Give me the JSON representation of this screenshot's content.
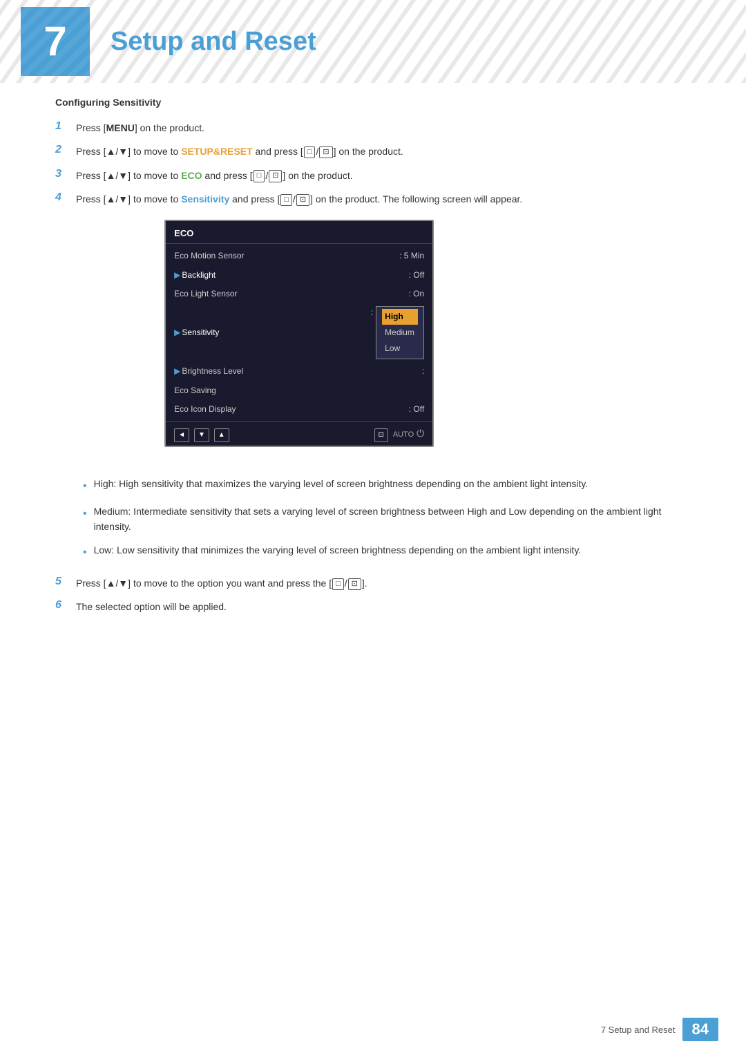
{
  "header": {
    "chapter_number": "7",
    "title": "Setup and Reset"
  },
  "section": {
    "heading": "Configuring Sensitivity"
  },
  "steps": [
    {
      "number": "1",
      "parts": [
        {
          "text": "Press [",
          "style": "normal"
        },
        {
          "text": "MENU",
          "style": "bold"
        },
        {
          "text": "] on the product.",
          "style": "normal"
        }
      ]
    },
    {
      "number": "2",
      "parts": [
        {
          "text": "Press [▲/▼] to move to ",
          "style": "normal"
        },
        {
          "text": "SETUP&RESET",
          "style": "orange"
        },
        {
          "text": " and press [",
          "style": "normal"
        },
        {
          "text": "□/⊡",
          "style": "icon"
        },
        {
          "text": "] on the product.",
          "style": "normal"
        }
      ]
    },
    {
      "number": "3",
      "parts": [
        {
          "text": "Press [▲/▼] to move to ",
          "style": "normal"
        },
        {
          "text": "ECO",
          "style": "green"
        },
        {
          "text": " and press [",
          "style": "normal"
        },
        {
          "text": "□/⊡",
          "style": "icon"
        },
        {
          "text": "] on the product.",
          "style": "normal"
        }
      ]
    },
    {
      "number": "4",
      "parts": [
        {
          "text": "Press [▲/▼] to move to ",
          "style": "normal"
        },
        {
          "text": "Sensitivity",
          "style": "blue"
        },
        {
          "text": " and press [",
          "style": "normal"
        },
        {
          "text": "□/⊡",
          "style": "icon"
        },
        {
          "text": "] on the product. The following screen will appear.",
          "style": "normal"
        }
      ]
    },
    {
      "number": "5",
      "parts": [
        {
          "text": "Press [▲/▼] to move to the option you want and press the [",
          "style": "normal"
        },
        {
          "text": "□/⊡",
          "style": "icon"
        },
        {
          "text": "].",
          "style": "normal"
        }
      ]
    },
    {
      "number": "6",
      "parts": [
        {
          "text": "The selected option will be applied.",
          "style": "normal"
        }
      ]
    }
  ],
  "menu": {
    "title": "ECO",
    "rows": [
      {
        "label": "Eco Motion Sensor",
        "value": ": 5 Min",
        "arrow": false
      },
      {
        "label": "Backlight",
        "value": ": Off",
        "arrow": true
      },
      {
        "label": "Eco Light Sensor",
        "value": ": On",
        "arrow": false
      },
      {
        "label": "Sensitivity",
        "value": "",
        "arrow": true,
        "has_submenu": true
      },
      {
        "label": "Brightness Level",
        "value": ":",
        "arrow": true
      },
      {
        "label": "Eco Saving",
        "value": "",
        "arrow": false
      },
      {
        "label": "Eco Icon Display",
        "value": ": Off",
        "arrow": false
      }
    ],
    "submenu_items": [
      "High",
      "Medium",
      "Low"
    ],
    "submenu_highlighted": "High"
  },
  "bullets": [
    {
      "label": "High",
      "label_style": "blue",
      "text": ": High sensitivity that maximizes the varying level of screen brightness depending on the ambient light intensity."
    },
    {
      "label": "Medium",
      "label_style": "blue",
      "text": ": Intermediate sensitivity that sets a varying level of screen brightness between ",
      "inline_highlights": [
        {
          "text": "High",
          "style": "orange"
        },
        {
          "text": " and "
        },
        {
          "text": "Low",
          "style": "orange"
        },
        {
          "text": " depending on the ambient light intensity."
        }
      ]
    },
    {
      "label": "Low",
      "label_style": "blue",
      "text": ": Low sensitivity that minimizes the varying level of screen brightness depending on the ambient light intensity."
    }
  ],
  "footer": {
    "chapter_label": "7 Setup and Reset",
    "page_number": "84"
  }
}
